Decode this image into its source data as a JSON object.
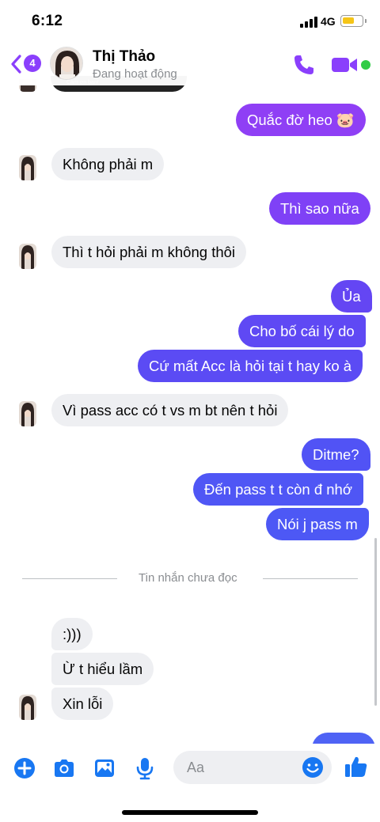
{
  "status_bar": {
    "time": "6:12",
    "network": "4G",
    "battery_level": 0.65
  },
  "header": {
    "unread_count": "4",
    "contact_name": "Thị Thảo",
    "contact_status": "Đang hoạt động",
    "accent_color": "#8a3ffc",
    "online_color": "#31cc46"
  },
  "messages": [
    {
      "text": "Quắc đờ heo 🐷",
      "side": "sent"
    },
    {
      "text": "Không phải m",
      "side": "recv"
    },
    {
      "text": "Thì sao nữa",
      "side": "sent"
    },
    {
      "text": "Thì t hỏi phải m không thôi",
      "side": "recv"
    },
    {
      "text": "Ủa",
      "side": "sent"
    },
    {
      "text": "Cho bố cái lý do",
      "side": "sent"
    },
    {
      "text": "Cứ mất Acc là hỏi tại t hay ko à",
      "side": "sent"
    },
    {
      "text": "Vì pass acc có t vs m bt nên t hỏi",
      "side": "recv"
    },
    {
      "text": "Ditme?",
      "side": "sent"
    },
    {
      "text": "Đến pass t t còn đ nhớ",
      "side": "sent"
    },
    {
      "text": "Nói j pass m",
      "side": "sent"
    },
    {
      "text": ":)))",
      "side": "recv"
    },
    {
      "text": "Ừ t hiểu lầm",
      "side": "recv"
    },
    {
      "text": "Xin lỗi",
      "side": "recv"
    }
  ],
  "unread_divider": "Tin nhắn chưa đọc",
  "composer": {
    "placeholder": "Aa",
    "icons": [
      "add-icon",
      "camera-icon",
      "gallery-icon",
      "microphone-icon",
      "emoji-icon",
      "like-icon"
    ],
    "icon_color": "#1877f2"
  }
}
